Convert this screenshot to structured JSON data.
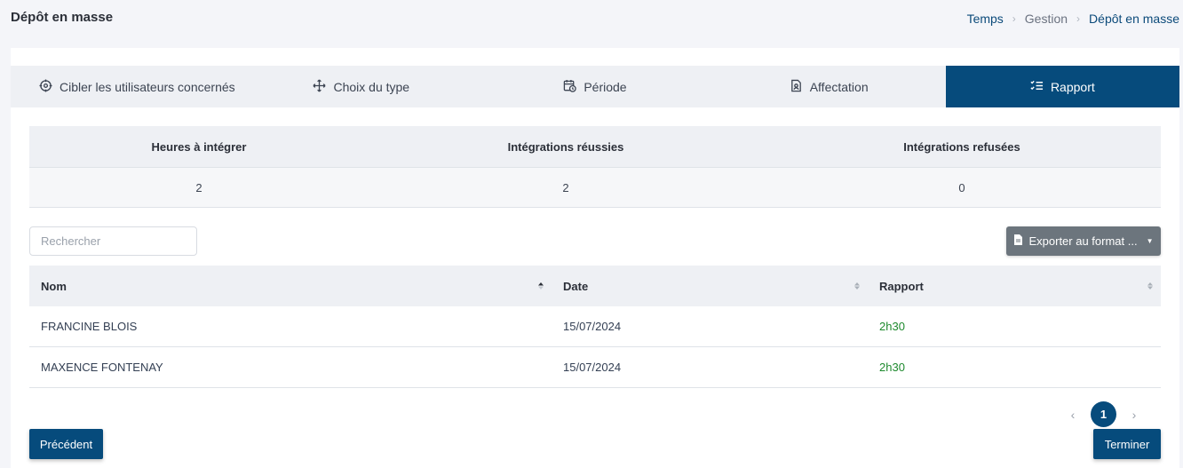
{
  "page": {
    "title": "Dépôt en masse"
  },
  "breadcrumb": [
    "Temps",
    "Gestion",
    "Dépôt en masse"
  ],
  "tabs": [
    {
      "label": "Cibler les utilisateurs concernés",
      "icon": "target-icon"
    },
    {
      "label": "Choix du type",
      "icon": "move-arrows-icon"
    },
    {
      "label": "Période",
      "icon": "calendar-clock-icon"
    },
    {
      "label": "Affectation",
      "icon": "user-document-icon"
    },
    {
      "label": "Rapport",
      "icon": "list-check-icon",
      "active": true
    }
  ],
  "summary": {
    "headers": [
      "Heures à intégrer",
      "Intégrations réussies",
      "Intégrations refusées"
    ],
    "values": [
      "2",
      "2",
      "0"
    ]
  },
  "search": {
    "placeholder": "Rechercher",
    "value": ""
  },
  "export": {
    "label": "Exporter au format ..."
  },
  "table": {
    "columns": [
      "Nom",
      "Date",
      "Rapport"
    ],
    "rows": [
      {
        "nom": "FRANCINE BLOIS",
        "date": "15/07/2024",
        "rapport": "2h30"
      },
      {
        "nom": "MAXENCE FONTENAY",
        "date": "15/07/2024",
        "rapport": "2h30"
      }
    ]
  },
  "pagination": {
    "current": "1",
    "prev": "‹",
    "next": "›"
  },
  "buttons": {
    "previous": "Précédent",
    "finish": "Terminer"
  },
  "colors": {
    "primary": "#064b7c",
    "success": "#1e8a2e",
    "secondary": "#6c757d"
  }
}
